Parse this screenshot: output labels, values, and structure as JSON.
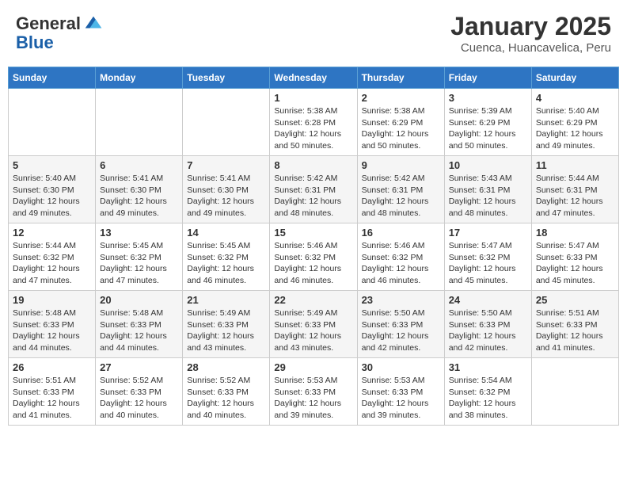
{
  "header": {
    "logo_line1": "General",
    "logo_line2": "Blue",
    "month_year": "January 2025",
    "location": "Cuenca, Huancavelica, Peru"
  },
  "days_of_week": [
    "Sunday",
    "Monday",
    "Tuesday",
    "Wednesday",
    "Thursday",
    "Friday",
    "Saturday"
  ],
  "weeks": [
    [
      {
        "day": "",
        "info": ""
      },
      {
        "day": "",
        "info": ""
      },
      {
        "day": "",
        "info": ""
      },
      {
        "day": "1",
        "info": "Sunrise: 5:38 AM\nSunset: 6:28 PM\nDaylight: 12 hours\nand 50 minutes."
      },
      {
        "day": "2",
        "info": "Sunrise: 5:38 AM\nSunset: 6:29 PM\nDaylight: 12 hours\nand 50 minutes."
      },
      {
        "day": "3",
        "info": "Sunrise: 5:39 AM\nSunset: 6:29 PM\nDaylight: 12 hours\nand 50 minutes."
      },
      {
        "day": "4",
        "info": "Sunrise: 5:40 AM\nSunset: 6:29 PM\nDaylight: 12 hours\nand 49 minutes."
      }
    ],
    [
      {
        "day": "5",
        "info": "Sunrise: 5:40 AM\nSunset: 6:30 PM\nDaylight: 12 hours\nand 49 minutes."
      },
      {
        "day": "6",
        "info": "Sunrise: 5:41 AM\nSunset: 6:30 PM\nDaylight: 12 hours\nand 49 minutes."
      },
      {
        "day": "7",
        "info": "Sunrise: 5:41 AM\nSunset: 6:30 PM\nDaylight: 12 hours\nand 49 minutes."
      },
      {
        "day": "8",
        "info": "Sunrise: 5:42 AM\nSunset: 6:31 PM\nDaylight: 12 hours\nand 48 minutes."
      },
      {
        "day": "9",
        "info": "Sunrise: 5:42 AM\nSunset: 6:31 PM\nDaylight: 12 hours\nand 48 minutes."
      },
      {
        "day": "10",
        "info": "Sunrise: 5:43 AM\nSunset: 6:31 PM\nDaylight: 12 hours\nand 48 minutes."
      },
      {
        "day": "11",
        "info": "Sunrise: 5:44 AM\nSunset: 6:31 PM\nDaylight: 12 hours\nand 47 minutes."
      }
    ],
    [
      {
        "day": "12",
        "info": "Sunrise: 5:44 AM\nSunset: 6:32 PM\nDaylight: 12 hours\nand 47 minutes."
      },
      {
        "day": "13",
        "info": "Sunrise: 5:45 AM\nSunset: 6:32 PM\nDaylight: 12 hours\nand 47 minutes."
      },
      {
        "day": "14",
        "info": "Sunrise: 5:45 AM\nSunset: 6:32 PM\nDaylight: 12 hours\nand 46 minutes."
      },
      {
        "day": "15",
        "info": "Sunrise: 5:46 AM\nSunset: 6:32 PM\nDaylight: 12 hours\nand 46 minutes."
      },
      {
        "day": "16",
        "info": "Sunrise: 5:46 AM\nSunset: 6:32 PM\nDaylight: 12 hours\nand 46 minutes."
      },
      {
        "day": "17",
        "info": "Sunrise: 5:47 AM\nSunset: 6:32 PM\nDaylight: 12 hours\nand 45 minutes."
      },
      {
        "day": "18",
        "info": "Sunrise: 5:47 AM\nSunset: 6:33 PM\nDaylight: 12 hours\nand 45 minutes."
      }
    ],
    [
      {
        "day": "19",
        "info": "Sunrise: 5:48 AM\nSunset: 6:33 PM\nDaylight: 12 hours\nand 44 minutes."
      },
      {
        "day": "20",
        "info": "Sunrise: 5:48 AM\nSunset: 6:33 PM\nDaylight: 12 hours\nand 44 minutes."
      },
      {
        "day": "21",
        "info": "Sunrise: 5:49 AM\nSunset: 6:33 PM\nDaylight: 12 hours\nand 43 minutes."
      },
      {
        "day": "22",
        "info": "Sunrise: 5:49 AM\nSunset: 6:33 PM\nDaylight: 12 hours\nand 43 minutes."
      },
      {
        "day": "23",
        "info": "Sunrise: 5:50 AM\nSunset: 6:33 PM\nDaylight: 12 hours\nand 42 minutes."
      },
      {
        "day": "24",
        "info": "Sunrise: 5:50 AM\nSunset: 6:33 PM\nDaylight: 12 hours\nand 42 minutes."
      },
      {
        "day": "25",
        "info": "Sunrise: 5:51 AM\nSunset: 6:33 PM\nDaylight: 12 hours\nand 41 minutes."
      }
    ],
    [
      {
        "day": "26",
        "info": "Sunrise: 5:51 AM\nSunset: 6:33 PM\nDaylight: 12 hours\nand 41 minutes."
      },
      {
        "day": "27",
        "info": "Sunrise: 5:52 AM\nSunset: 6:33 PM\nDaylight: 12 hours\nand 40 minutes."
      },
      {
        "day": "28",
        "info": "Sunrise: 5:52 AM\nSunset: 6:33 PM\nDaylight: 12 hours\nand 40 minutes."
      },
      {
        "day": "29",
        "info": "Sunrise: 5:53 AM\nSunset: 6:33 PM\nDaylight: 12 hours\nand 39 minutes."
      },
      {
        "day": "30",
        "info": "Sunrise: 5:53 AM\nSunset: 6:33 PM\nDaylight: 12 hours\nand 39 minutes."
      },
      {
        "day": "31",
        "info": "Sunrise: 5:54 AM\nSunset: 6:32 PM\nDaylight: 12 hours\nand 38 minutes."
      },
      {
        "day": "",
        "info": ""
      }
    ]
  ]
}
